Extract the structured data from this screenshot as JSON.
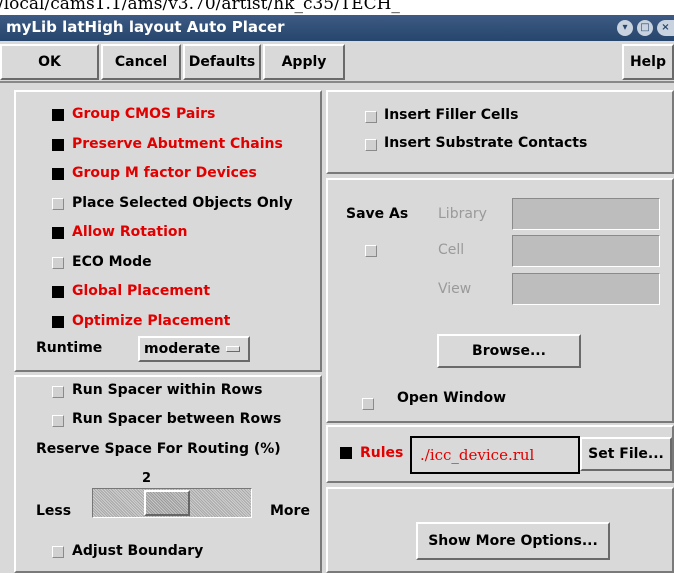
{
  "path_strip": "/local/cams1.1/ams/v3.70/artist/hk_c35/TECH_",
  "window": {
    "title": "myLib latHigh layout Auto Placer"
  },
  "toolbar": {
    "ok": "OK",
    "cancel": "Cancel",
    "defaults": "Defaults",
    "apply": "Apply",
    "help": "Help"
  },
  "options": [
    {
      "label": "Group CMOS Pairs",
      "checked": true,
      "highlight": true
    },
    {
      "label": "Preserve Abutment Chains",
      "checked": true,
      "highlight": true
    },
    {
      "label": "Group M factor Devices",
      "checked": true,
      "highlight": true
    },
    {
      "label": "Place Selected Objects Only",
      "checked": false,
      "highlight": false
    },
    {
      "label": "Allow Rotation",
      "checked": true,
      "highlight": true
    },
    {
      "label": "ECO Mode",
      "checked": false,
      "highlight": false
    },
    {
      "label": "Global Placement",
      "checked": true,
      "highlight": true
    },
    {
      "label": "Optimize Placement",
      "checked": true,
      "highlight": true
    }
  ],
  "runtime": {
    "label": "Runtime",
    "value": "moderate"
  },
  "spacer": {
    "within_rows": "Run Spacer within Rows",
    "between_rows": "Run Spacer between Rows",
    "reserve_label": "Reserve Space For Routing (%)",
    "reserve_value": "2",
    "less": "Less",
    "more": "More",
    "adjust_boundary": "Adjust Boundary"
  },
  "filler": {
    "insert_filler": "Insert Filler Cells",
    "insert_substrate": "Insert Substrate Contacts"
  },
  "save_as": {
    "label": "Save As",
    "library": "Library",
    "cell": "Cell",
    "view": "View",
    "browse": "Browse...",
    "open_window": "Open Window"
  },
  "rules": {
    "label": "Rules",
    "file": "./icc_device.rul",
    "set_file": "Set File..."
  },
  "more_options": "Show More Options...",
  "colors": {
    "title_bar": "#27466d",
    "highlight_text": "#e00000",
    "background": "#d9d9d9"
  }
}
